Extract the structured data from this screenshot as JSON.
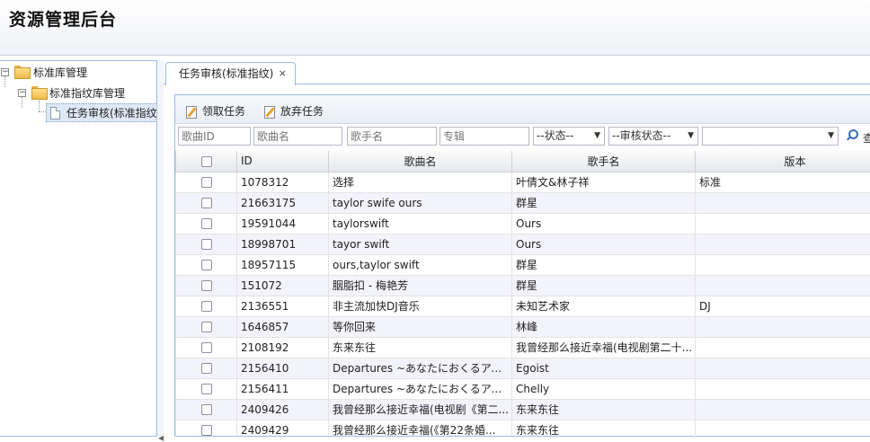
{
  "app": {
    "title": "资源管理后台"
  },
  "tree": {
    "root": {
      "label": "标准库管理"
    },
    "child": {
      "label": "标准指纹库管理"
    },
    "leaf": {
      "label": "任务审核(标准指纹"
    }
  },
  "tabs": [
    {
      "label": "任务审核(标准指纹)",
      "close": "×"
    }
  ],
  "toolbar": {
    "claim_label": "领取任务",
    "abandon_label": "放弃任务"
  },
  "filters": {
    "song_id_placeholder": "歌曲ID",
    "song_name_placeholder": "歌曲名",
    "singer_placeholder": "歌手名",
    "album_placeholder": "专辑",
    "status_value": "--状态--",
    "review_status_value": "--审核状态--",
    "extra_value": "",
    "search_label": "查"
  },
  "grid": {
    "columns": {
      "id": "ID",
      "song": "歌曲名",
      "singer": "歌手名",
      "version": "版本"
    },
    "rows": [
      {
        "id": "1078312",
        "song": "选择",
        "singer": "叶倩文&林子祥",
        "version": "标准"
      },
      {
        "id": "21663175",
        "song": "taylor swife ours",
        "singer": "群星",
        "version": ""
      },
      {
        "id": "19591044",
        "song": "taylorswift",
        "singer": "Ours",
        "version": ""
      },
      {
        "id": "18998701",
        "song": "tayor swift",
        "singer": "Ours",
        "version": ""
      },
      {
        "id": "18957115",
        "song": "ours,taylor swift",
        "singer": "群星",
        "version": ""
      },
      {
        "id": "151072",
        "song": "胭脂扣 - 梅艳芳",
        "singer": "群星",
        "version": ""
      },
      {
        "id": "2136551",
        "song": "非主流加快DJ音乐",
        "singer": "未知艺术家",
        "version": "DJ"
      },
      {
        "id": "1646857",
        "song": "等你回来",
        "singer": "林峰",
        "version": ""
      },
      {
        "id": "2108192",
        "song": "东来东往",
        "singer": "我曾经那么接近幸福(电视剧第二十...",
        "version": ""
      },
      {
        "id": "2156410",
        "song": "Departures ~あなたにおくるアイ(...",
        "singer": "Egoist",
        "version": ""
      },
      {
        "id": "2156411",
        "song": "Departures ~あなたにおくるアイ...",
        "singer": "Chelly",
        "version": ""
      },
      {
        "id": "2409426",
        "song": "我曾经那么接近幸福(电视剧《第二...",
        "singer": "东来东往",
        "version": ""
      },
      {
        "id": "2409429",
        "song": "我曾经那么接近幸福(《第22条婚...",
        "singer": "东来东往",
        "version": ""
      }
    ]
  }
}
